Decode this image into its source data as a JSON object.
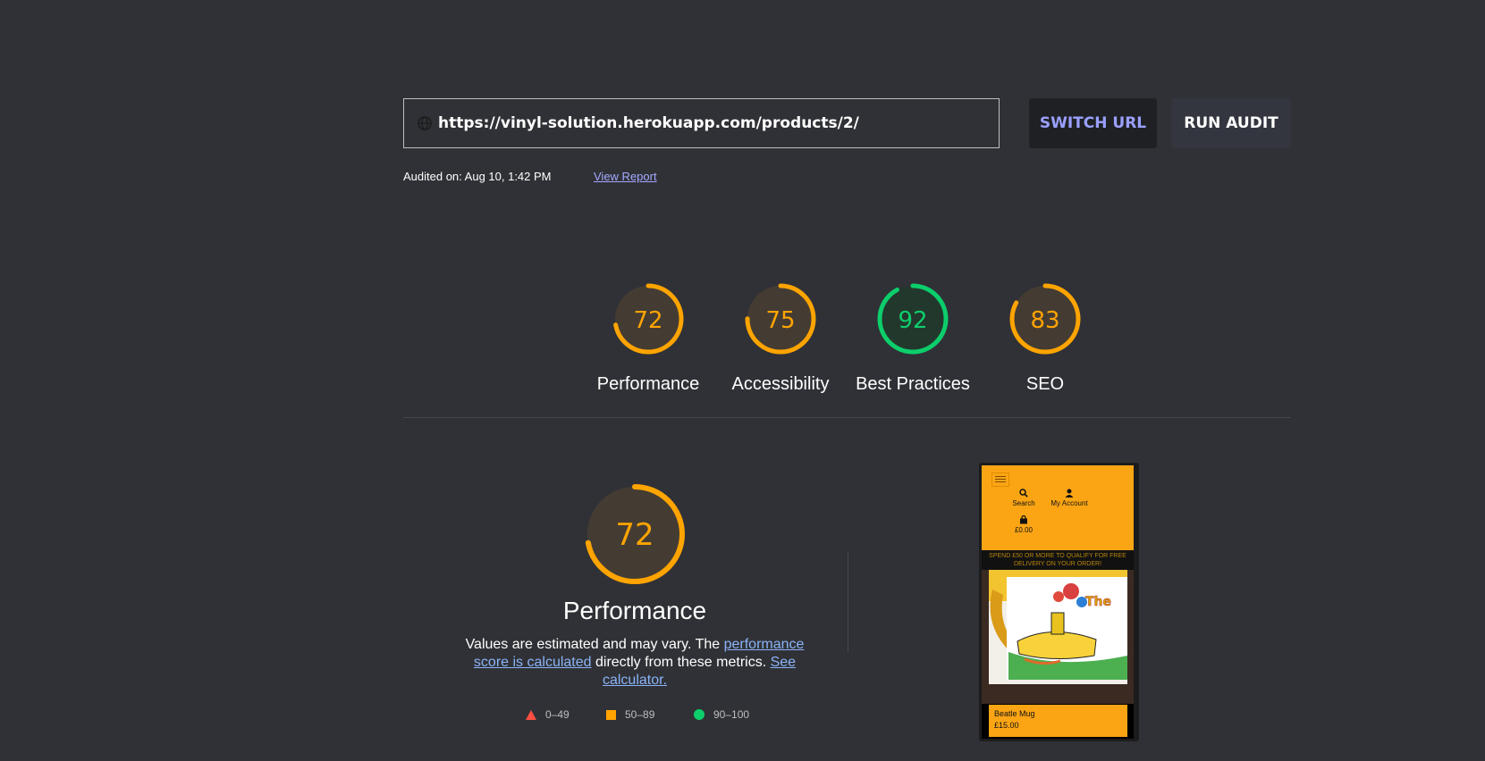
{
  "url_bar": {
    "value": "https://vinyl-solution.herokuapp.com/products/2/",
    "icon": "globe-icon"
  },
  "buttons": {
    "switch_url": "SWITCH URL",
    "run_audit": "RUN AUDIT"
  },
  "audit": {
    "audited_on": "Audited on: Aug 10, 1:42 PM",
    "view_report": "View Report"
  },
  "scores": [
    {
      "label": "Performance",
      "value": "72",
      "score": 72,
      "color": "#ffa400"
    },
    {
      "label": "Accessibility",
      "value": "75",
      "score": 75,
      "color": "#ffa400"
    },
    {
      "label": "Best Practices",
      "value": "92",
      "score": 92,
      "color": "#0cce6b"
    },
    {
      "label": "SEO",
      "value": "83",
      "score": 83,
      "color": "#ffa400"
    }
  ],
  "performance": {
    "score": 72,
    "value": "72",
    "title": "Performance",
    "desc_prefix": "Values are estimated and may vary. The ",
    "desc_link1": "performance score is calculated",
    "desc_middle": " directly from these metrics. ",
    "desc_link2": "See calculator."
  },
  "legend": [
    {
      "range": "0–49",
      "color": "#ff4e42",
      "shape": "triangle"
    },
    {
      "range": "50–89",
      "color": "#ffa400",
      "shape": "square"
    },
    {
      "range": "90–100",
      "color": "#0cce6b",
      "shape": "circle"
    }
  ],
  "screenshot": {
    "search_label": "Search",
    "account_label": "My Account",
    "basket_total": "£0.00",
    "promo": "SPEND £50 OR MORE TO QUALIFY FOR FREE DELIVERY ON YOUR ORDER!",
    "product_name": "Beatle Mug",
    "product_price": "£15.00"
  },
  "colors": {
    "background": "#303136",
    "pass": "#0cce6b",
    "average": "#ffa400",
    "fail": "#ff4e42",
    "link": "#8ab4f8",
    "accent": "#9aa0ff"
  }
}
